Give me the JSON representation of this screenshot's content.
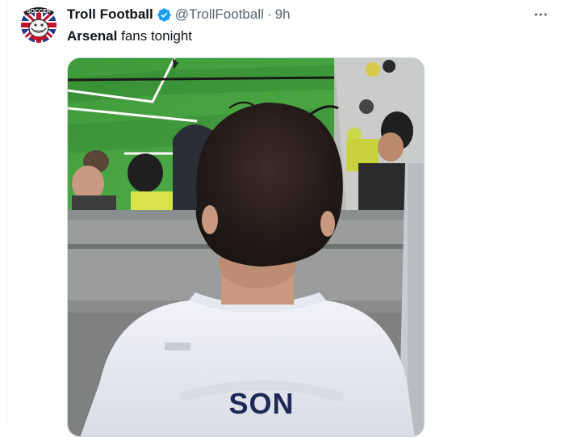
{
  "tweet": {
    "display_name": "Troll Football",
    "handle": "@TrollFootball",
    "separator": "·",
    "time": "9h",
    "text_highlight": "Arsenal",
    "text_rest": " fans tonight"
  },
  "avatar": {
    "badge_text": "SOCCER",
    "icon": "troll-face-union-jack-logo"
  },
  "media": {
    "shirt_name": "SON",
    "description_icon": "stadium-photo"
  },
  "colors": {
    "verified": "#1d9bf0",
    "secondary_text": "#536471",
    "border": "#cfd9de"
  }
}
